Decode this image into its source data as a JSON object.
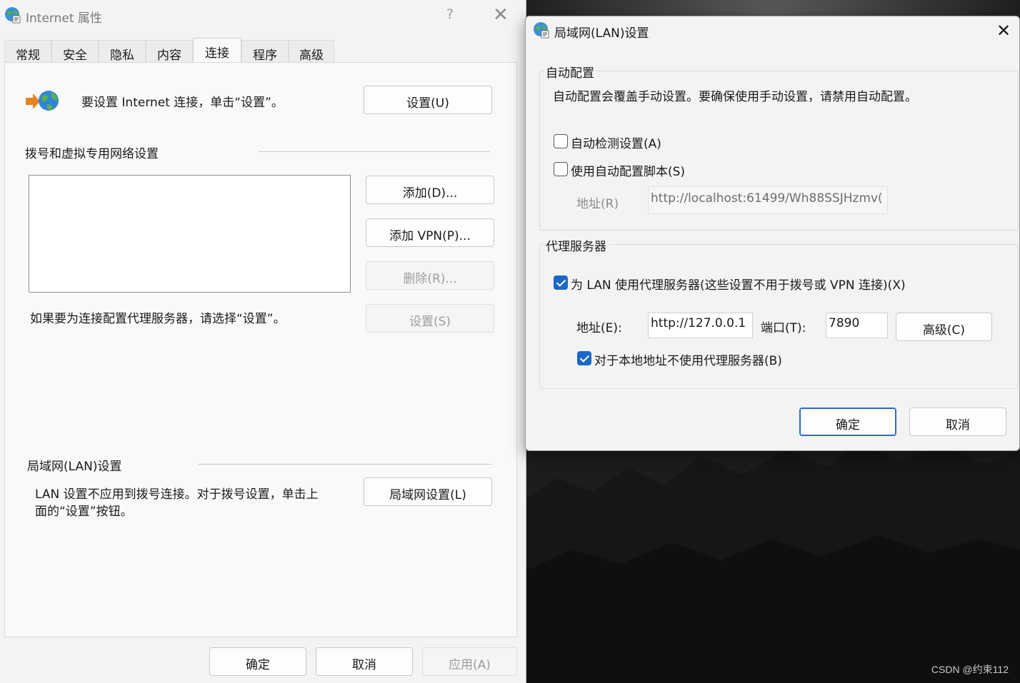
{
  "props": {
    "title": "Internet 属性",
    "help": "?",
    "close": "✕",
    "tabs": [
      "常规",
      "安全",
      "隐私",
      "内容",
      "连接",
      "程序",
      "高级"
    ],
    "active_tab": "连接",
    "setup_text": "要设置 Internet 连接，单击“设置”。",
    "setup_button": "设置(U)",
    "dialup_heading": "拨号和虚拟专用网络设置",
    "add_button": "添加(D)...",
    "add_vpn_button": "添加 VPN(P)...",
    "remove_button": "删除(R)...",
    "proxy_hint": "如果要为连接配置代理服务器，请选择“设置”。",
    "settings_button": "设置(S)",
    "lan_heading": "局域网(LAN)设置",
    "lan_text_1": "LAN 设置不应用到拨号连接。对于拨号设置，单击上",
    "lan_text_2": "面的“设置”按钮。",
    "lan_button": "局域网设置(L)",
    "ok": "确定",
    "cancel": "取消",
    "apply": "应用(A)"
  },
  "lan": {
    "title": "局域网(LAN)设置",
    "close": "✕",
    "auto_group": "自动配置",
    "auto_desc": "自动配置会覆盖手动设置。要确保使用手动设置，请禁用自动配置。",
    "auto_detect": "自动检测设置(A)",
    "auto_detect_checked": false,
    "use_script": "使用自动配置脚本(S)",
    "use_script_checked": false,
    "script_addr_label": "地址(R)",
    "script_addr_value": "http://localhost:61499/Wh88SSJHzmv(",
    "proxy_group": "代理服务器",
    "use_proxy": "为 LAN 使用代理服务器(这些设置不用于拨号或 VPN 连接)(X)",
    "use_proxy_checked": true,
    "addr_label": "地址(E):",
    "addr_value": "http://127.0.0.1",
    "port_label": "端口(T):",
    "port_value": "7890",
    "advanced_button": "高级(C)",
    "bypass_local": "对于本地地址不使用代理服务器(B)",
    "bypass_local_checked": true,
    "ok": "确定",
    "cancel": "取消"
  },
  "watermark": "CSDN @约束112",
  "colors": {
    "accent": "#1a67c7"
  }
}
